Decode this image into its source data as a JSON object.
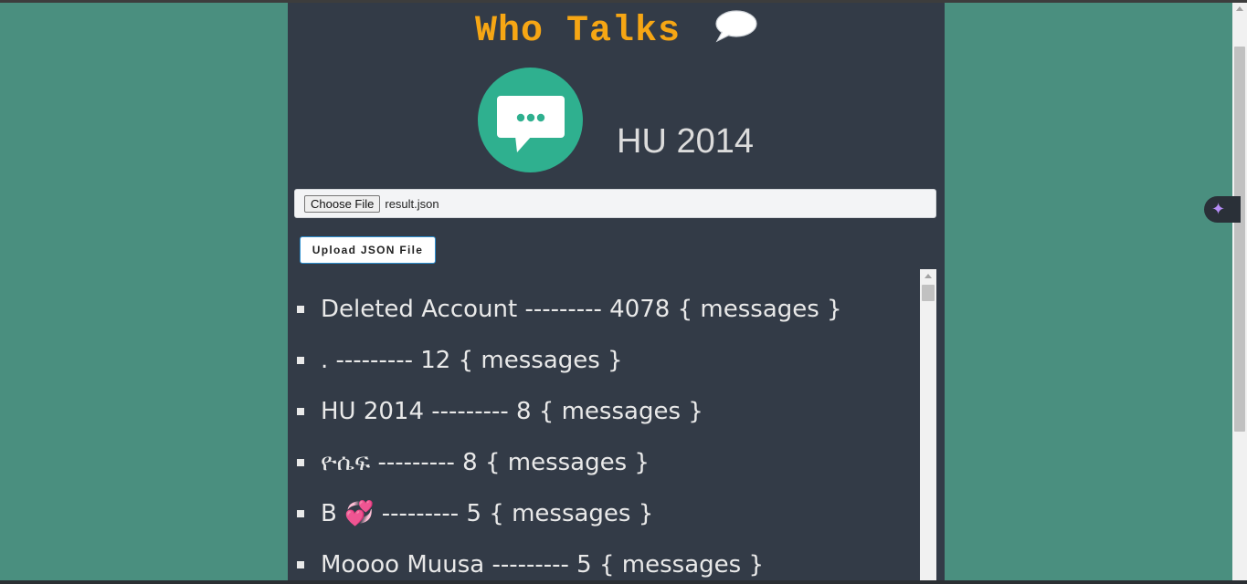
{
  "app": {
    "title": "Who Talks",
    "group_name": "HU 2014"
  },
  "file_input": {
    "button_label": "Choose File",
    "file_name": "result.json"
  },
  "upload_button": {
    "label": "Upload JSON File"
  },
  "separator": "---------",
  "unit_label": "{ messages }",
  "ranking": [
    {
      "name": "Deleted Account",
      "count": "4078"
    },
    {
      "name": ".",
      "count": "12"
    },
    {
      "name": "HU 2014",
      "count": "8"
    },
    {
      "name": "ዮሴፍ",
      "count": "8"
    },
    {
      "name": "B 💞",
      "count": "5"
    },
    {
      "name": "Moooo Muusa",
      "count": "5"
    }
  ],
  "colors": {
    "page_background": "#4a8f7f",
    "panel_background": "#333b47",
    "title": "#f6a614",
    "logo_circle": "#2fb08f",
    "upload_border": "#2d8fd0"
  },
  "icons": {
    "title_icon": "speech-bubble-icon",
    "logo_icon": "chat-dots-icon",
    "assistant_icon": "sparkle-icon"
  }
}
